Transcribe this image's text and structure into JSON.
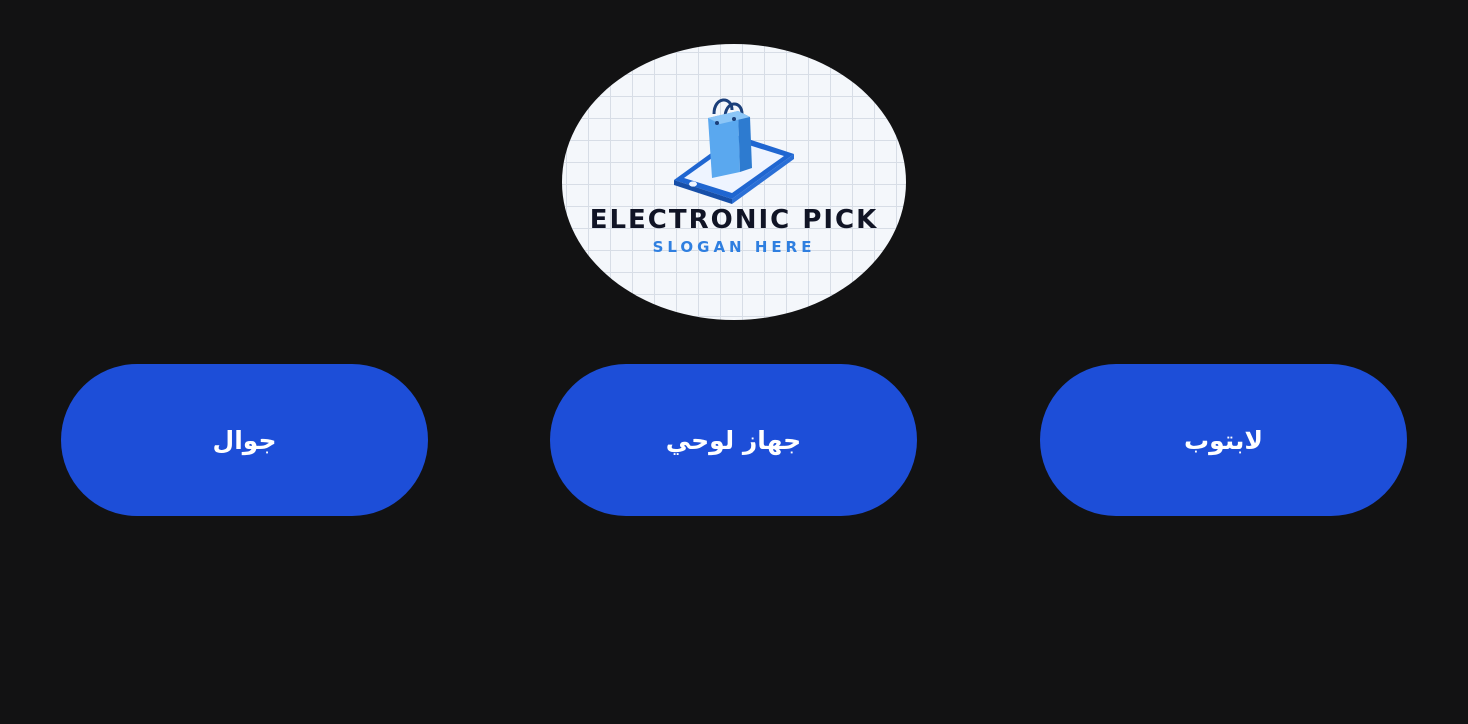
{
  "logo": {
    "title": "ELECTRONIC PICK",
    "slogan": "SLOGAN HERE",
    "icon": "shopping-bag-on-phone-icon",
    "colors": {
      "bag": "#4a9be8",
      "phone": "#1f66d1",
      "title": "#101425",
      "slogan": "#2f7fe0"
    }
  },
  "categories": [
    {
      "label": "جوال"
    },
    {
      "label": "جهاز لوحي"
    },
    {
      "label": "لابتوب"
    }
  ],
  "colors": {
    "background": "#121213",
    "button": "#1d4ed8",
    "button_text": "#ffffff"
  }
}
